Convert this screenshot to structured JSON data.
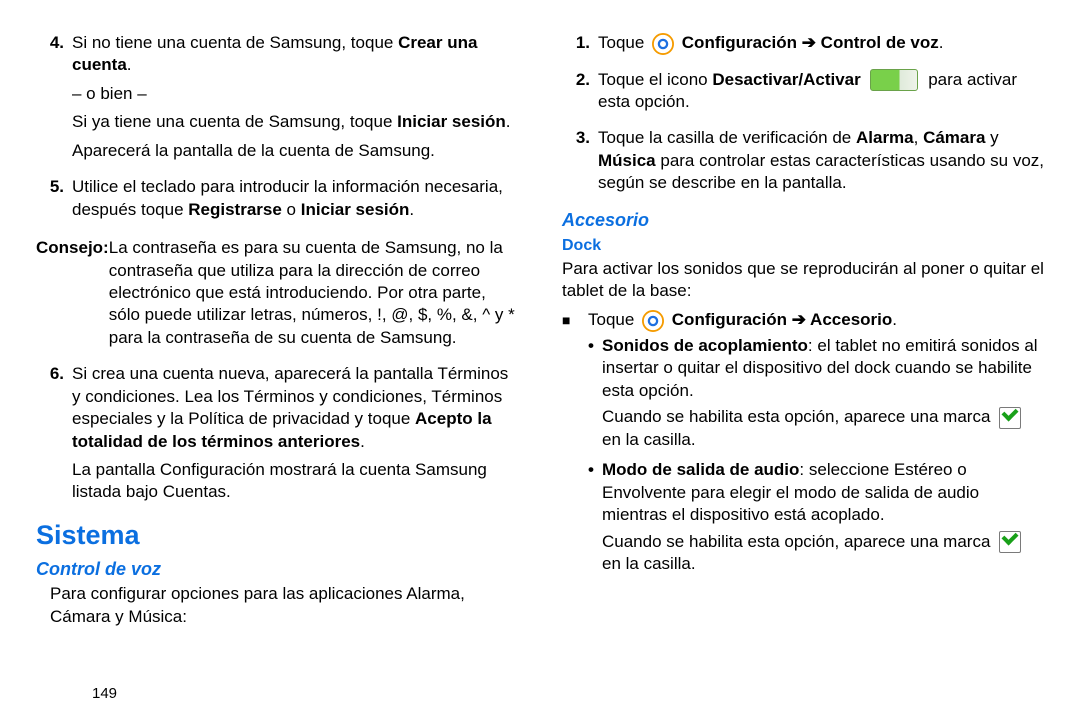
{
  "page_number": "149",
  "left": {
    "step4": {
      "num": "4.",
      "t1a": "Si no tiene una cuenta de Samsung, toque ",
      "t1b": "Crear una cuenta",
      "t1c": ".",
      "or": "– o bien –",
      "t2a": "Si ya tiene una cuenta de Samsung, toque ",
      "t2b": "Iniciar sesión",
      "t2c": ".",
      "t3": "Aparecerá la pantalla de la cuenta de Samsung."
    },
    "step5": {
      "num": "5.",
      "t1a": "Utilice el teclado para introducir la información necesaria, después toque ",
      "t1b": "Registrarse",
      "t1c": " o ",
      "t1d": "Iniciar sesión",
      "t1e": "."
    },
    "tip": {
      "label": "Consejo:",
      "text": "La contraseña es para su cuenta de Samsung, no la contraseña que utiliza para la dirección de correo electrónico que está introduciendo. Por otra parte, sólo puede utilizar letras, números, !, @, $, %, &, ^ y * para la contraseña de su cuenta de Samsung."
    },
    "step6": {
      "num": "6.",
      "t1a": "Si crea una cuenta nueva, aparecerá la pantalla Términos y condiciones. Lea los Términos y condiciones, Términos especiales y la Política de privacidad y toque ",
      "t1b": "Acepto la totalidad de los términos anteriores",
      "t1c": ".",
      "t2": "La pantalla Configuración mostrará la cuenta Samsung listada bajo Cuentas."
    },
    "h1": "Sistema",
    "h2": "Control de voz",
    "intro": "Para configurar opciones para las aplicaciones Alarma, Cámara y Música:"
  },
  "right": {
    "step1": {
      "num": "1.",
      "pre": "Toque ",
      "link": "Configuración ➔ Control de voz",
      "post": "."
    },
    "step2": {
      "num": "2.",
      "pre": "Toque el icono ",
      "bold": "Desactivar/Activar",
      "post": " para activar esta opción."
    },
    "step3": {
      "num": "3.",
      "a": "Toque la casilla de verificación de ",
      "b": "Alarma",
      "c": ", ",
      "d": "Cámara",
      "e": " y ",
      "f": "Música",
      "g": " para controlar estas características usando su voz, según se describe en la pantalla."
    },
    "h2": "Accesorio",
    "h3": "Dock",
    "intro": "Para activar los sonidos que se reproducirán al poner o quitar el tablet de la base:",
    "bullet": {
      "pre": "Toque ",
      "link": "Configuración ➔ Accesorio",
      "post": "."
    },
    "d1": {
      "a": "Sonidos de acoplamiento",
      "b": ": el tablet no emitirá sonidos al insertar o quitar el dispositivo del dock cuando se habilite esta opción.",
      "c": "Cuando se habilita esta opción, aparece una marca",
      "d": " en la casilla."
    },
    "d2": {
      "a": "Modo de salida de audio",
      "b": ": seleccione Estéreo o Envolvente para elegir el modo de salida de audio mientras el dispositivo está acoplado.",
      "c": "Cuando se habilita esta opción, aparece una marca",
      "d": " en la casilla."
    }
  }
}
